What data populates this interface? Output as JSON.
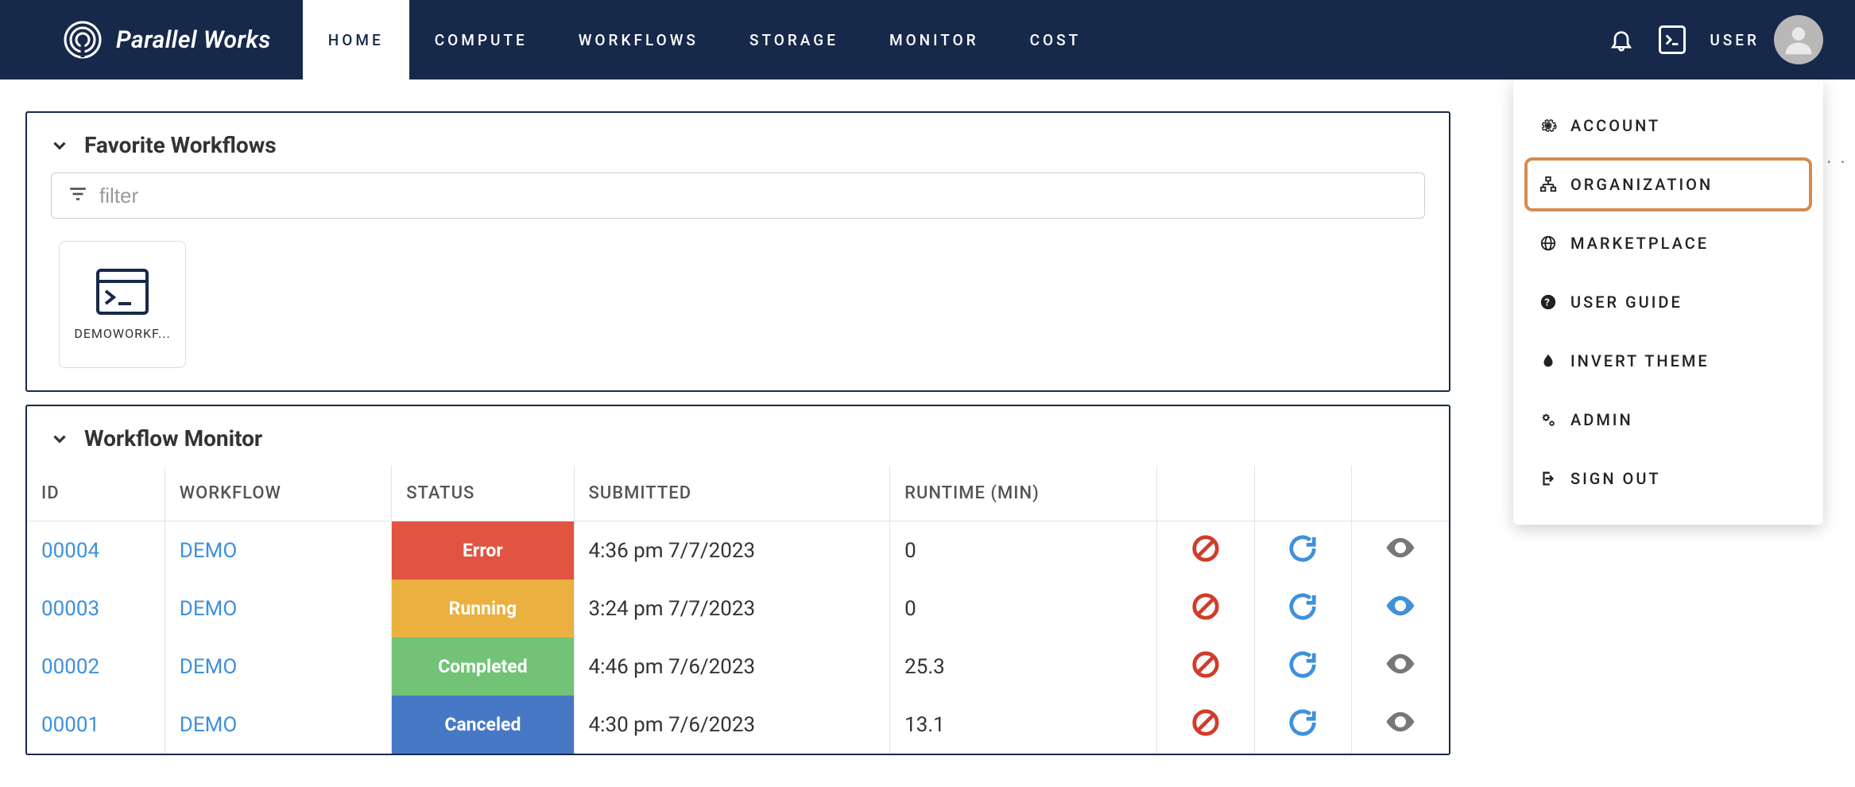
{
  "brand": {
    "name": "Parallel Works"
  },
  "nav": {
    "items": [
      {
        "label": "HOME",
        "active": true
      },
      {
        "label": "COMPUTE",
        "active": false
      },
      {
        "label": "WORKFLOWS",
        "active": false
      },
      {
        "label": "STORAGE",
        "active": false
      },
      {
        "label": "MONITOR",
        "active": false
      },
      {
        "label": "COST",
        "active": false
      }
    ],
    "user_label": "USER"
  },
  "favorites": {
    "title": "Favorite Workflows",
    "filter_placeholder": "filter",
    "cards": [
      {
        "label": "DEMOWORKF..."
      }
    ]
  },
  "monitor": {
    "title": "Workflow Monitor",
    "columns": {
      "id": "ID",
      "workflow": "WORKFLOW",
      "status": "STATUS",
      "submitted": "SUBMITTED",
      "runtime": "RUNTIME (MIN)"
    },
    "rows": [
      {
        "id": "00004",
        "workflow": "DEMO",
        "status": "Error",
        "status_class": "status-error",
        "submitted": "4:36 pm 7/7/2023",
        "runtime": "0",
        "eye_active": false
      },
      {
        "id": "00003",
        "workflow": "DEMO",
        "status": "Running",
        "status_class": "status-running",
        "submitted": "3:24 pm 7/7/2023",
        "runtime": "0",
        "eye_active": true
      },
      {
        "id": "00002",
        "workflow": "DEMO",
        "status": "Completed",
        "status_class": "status-completed",
        "submitted": "4:46 pm 7/6/2023",
        "runtime": "25.3",
        "eye_active": false
      },
      {
        "id": "00001",
        "workflow": "DEMO",
        "status": "Canceled",
        "status_class": "status-canceled",
        "submitted": "4:30 pm 7/6/2023",
        "runtime": "13.1",
        "eye_active": false
      }
    ]
  },
  "user_menu": {
    "items": [
      {
        "label": "ACCOUNT",
        "icon": "gear-icon",
        "highlight": false
      },
      {
        "label": "ORGANIZATION",
        "icon": "org-icon",
        "highlight": true
      },
      {
        "label": "MARKETPLACE",
        "icon": "globe-icon",
        "highlight": false
      },
      {
        "label": "USER GUIDE",
        "icon": "help-icon",
        "highlight": false
      },
      {
        "label": "INVERT THEME",
        "icon": "drop-icon",
        "highlight": false
      },
      {
        "label": "ADMIN",
        "icon": "gears-icon",
        "highlight": false
      },
      {
        "label": "SIGN OUT",
        "icon": "signout-icon",
        "highlight": false
      }
    ]
  },
  "colors": {
    "navy": "#17294a",
    "link": "#4090da",
    "error": "#e15441",
    "running": "#eab040",
    "completed": "#72c376",
    "canceled": "#4778c6",
    "highlight_border": "#d58b4f"
  }
}
